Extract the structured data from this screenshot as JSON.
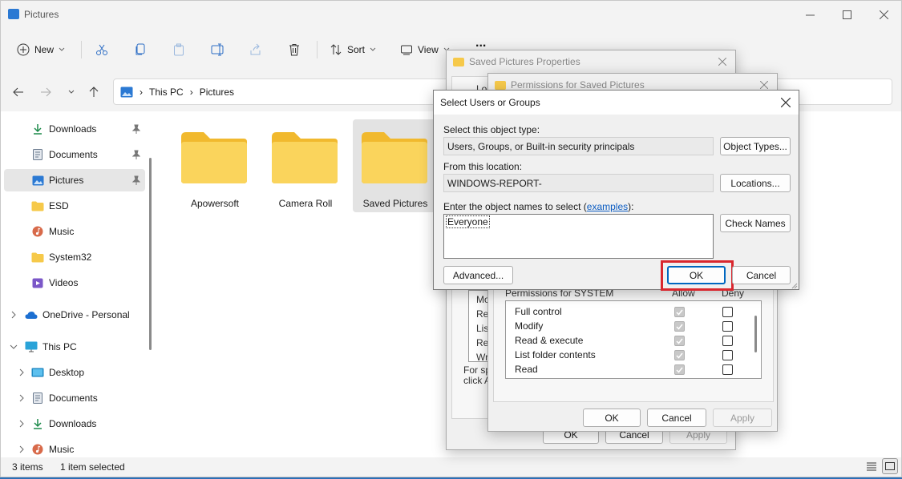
{
  "window": {
    "title": "Pictures"
  },
  "toolbar": {
    "new_label": "New",
    "sort_label": "Sort",
    "view_label": "View",
    "more_label": "..."
  },
  "address": {
    "crumbs": [
      "This PC",
      "Pictures"
    ]
  },
  "sidebar": {
    "quick": [
      {
        "label": "Downloads",
        "icon": "download-icon"
      },
      {
        "label": "Documents",
        "icon": "document-icon"
      },
      {
        "label": "Pictures",
        "icon": "pictures-icon"
      },
      {
        "label": "ESD",
        "icon": "folder-icon"
      },
      {
        "label": "Music",
        "icon": "music-icon"
      },
      {
        "label": "System32",
        "icon": "folder-icon"
      },
      {
        "label": "Videos",
        "icon": "video-icon"
      }
    ],
    "onedrive": "OneDrive - Personal",
    "thispc": "This PC",
    "thispc_children": [
      {
        "label": "Desktop",
        "icon": "desktop-icon"
      },
      {
        "label": "Documents",
        "icon": "document-icon"
      },
      {
        "label": "Downloads",
        "icon": "download-icon"
      },
      {
        "label": "Music",
        "icon": "music-icon"
      }
    ]
  },
  "files": [
    {
      "name": "Apowersoft"
    },
    {
      "name": "Camera Roll"
    },
    {
      "name": "Saved Pictures"
    }
  ],
  "status": {
    "count": "3 items",
    "selected": "1 item selected"
  },
  "properties_dialog": {
    "title": "Saved Pictures Properties",
    "buttons": {
      "ok": "OK",
      "cancel": "Cancel",
      "apply": "Apply"
    },
    "fragments": [
      "Loc",
      "Mod",
      "Rea",
      "List",
      "Rea",
      "Writ",
      "For spe",
      "click A"
    ]
  },
  "permissions_dialog": {
    "title": "Permissions for Saved Pictures",
    "perm_header": "Permissions for SYSTEM",
    "allow_label": "Allow",
    "deny_label": "Deny",
    "rows": [
      {
        "label": "Full control"
      },
      {
        "label": "Modify"
      },
      {
        "label": "Read & execute"
      },
      {
        "label": "List folder contents"
      },
      {
        "label": "Read"
      }
    ],
    "buttons": {
      "ok": "OK",
      "cancel": "Cancel",
      "apply": "Apply"
    }
  },
  "select_dialog": {
    "title": "Select Users or Groups",
    "object_type_label": "Select this object type:",
    "object_type_value": "Users, Groups, or Built-in security principals",
    "object_types_button": "Object Types...",
    "location_label": "From this location:",
    "location_value": "WINDOWS-REPORT-",
    "locations_button": "Locations...",
    "names_label_prefix": "Enter the object names to select (",
    "names_label_link": "examples",
    "names_label_suffix": "):",
    "names_value": "Everyone",
    "check_names_button": "Check Names",
    "advanced_button": "Advanced...",
    "ok_button": "OK",
    "cancel_button": "Cancel",
    "highlight_color": "#d9272e"
  }
}
